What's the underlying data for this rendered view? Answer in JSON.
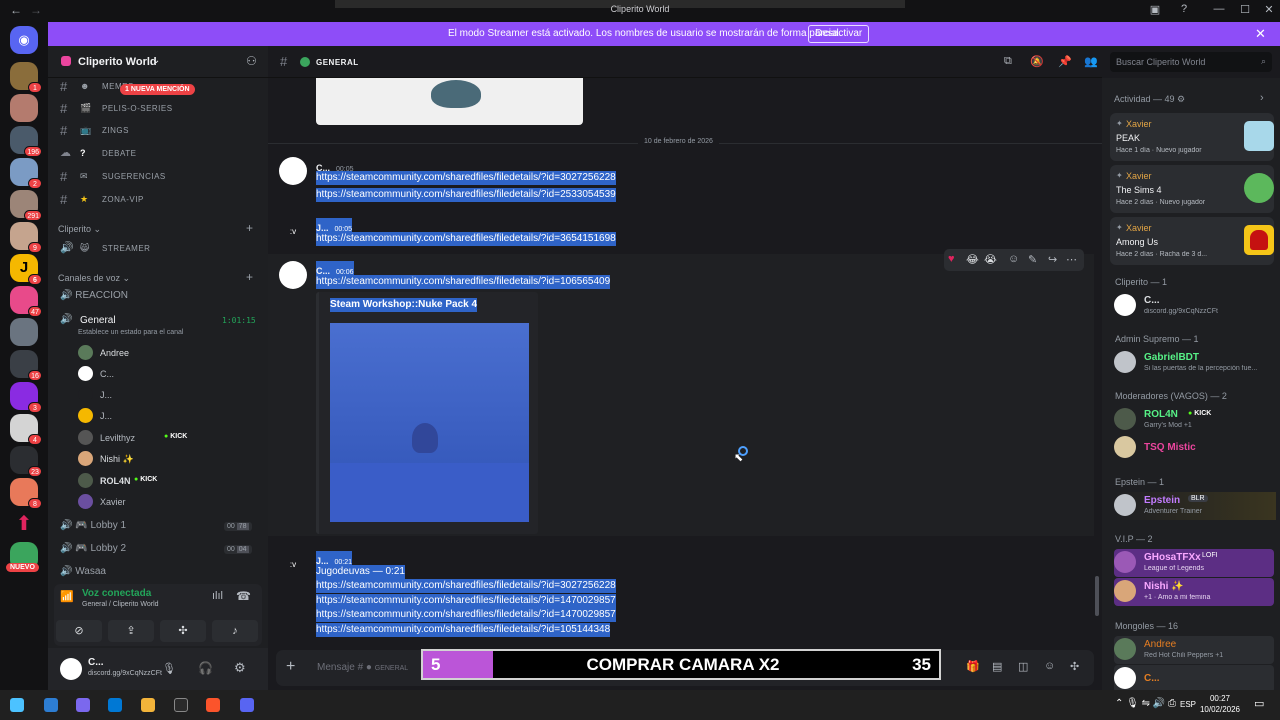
{
  "window": {
    "title": "Cliperito World"
  },
  "banner": {
    "text": "El modo Streamer está activado. Los nombres de usuario se mostrarán de forma parcial.",
    "button": "Desactivar"
  },
  "rail": {
    "badges": [
      "1",
      "196",
      "2",
      "291",
      "9",
      "6",
      "47",
      "16",
      "3",
      "4",
      "23",
      "8"
    ],
    "new_label": "NUEVO"
  },
  "sidebar": {
    "server_name": "Cliperito World",
    "mention_pill": "1 NUEVA MENCIÓN",
    "channels": [
      {
        "emoji": "☻",
        "label": "MEMES"
      },
      {
        "emoji": "🎬",
        "label": "PELIS-O-SERIES"
      },
      {
        "emoji": "📺",
        "label": "ZINGS"
      },
      {
        "emoji": "?",
        "label": "DEBATE"
      },
      {
        "emoji": "✉",
        "label": "SUGERENCIAS"
      },
      {
        "emoji": "★",
        "label": "ZONA-VIP"
      }
    ],
    "cat_cliperito": "Cliperito",
    "streamer_channel": "STREAMER",
    "cat_voice": "Canales de voz",
    "reaccion": "REACCION",
    "general_voice": "General",
    "general_time": "1:01:15",
    "general_status": "Establece un estado para el canal",
    "voice_users": [
      {
        "name": "Andree",
        "color": "#dbdee1"
      },
      {
        "name": "C...",
        "color": "#b5bac1"
      },
      {
        "name": "J...",
        "color": "#b5bac1"
      },
      {
        "name": "J...",
        "color": "#b5bac1"
      },
      {
        "name": "Levilthyz",
        "color": "#b5bac1",
        "tag": "KICK"
      },
      {
        "name": "Nishi ✨",
        "color": "#dbdee1"
      },
      {
        "name": "ROL4N",
        "color": "#dbdee1",
        "tag": "KICK"
      },
      {
        "name": "Xavier",
        "color": "#b5bac1"
      }
    ],
    "lobby1": "Lobby 1",
    "lobby1_a": "00",
    "lobby1_b": "78",
    "lobby2": "Lobby 2",
    "lobby2_a": "00",
    "lobby2_b": "04",
    "wasaa": "Wasaa",
    "voice_connected": "Voz conectada",
    "voice_location": "General / Cliperito World",
    "user_name": "C...",
    "user_status": "discord.gg/9xCqNzzCFt"
  },
  "chat": {
    "channel_name": "GENERAL",
    "date_divider": "10 de febrero de 2026",
    "messages": [
      {
        "author": "C...",
        "time": "00:05",
        "links": [
          "https://steamcommunity.com/sharedfiles/filedetails/?id=3027256228",
          "https://steamcommunity.com/sharedfiles/filedetails/?id=2533054539"
        ]
      },
      {
        "author": "J...",
        "time": "00:05",
        "links": [
          "https://steamcommunity.com/sharedfiles/filedetails/?id=3654151698"
        ]
      },
      {
        "author": "C...",
        "time": "00:06",
        "links": [
          "https://steamcommunity.com/sharedfiles/filedetails/?id=106565409"
        ]
      },
      {
        "author": "J...",
        "time": "00:21",
        "links": [
          "Jugodeuvas — 0:21",
          "https://steamcommunity.com/sharedfiles/filedetails/?id=3027256228",
          "https://steamcommunity.com/sharedfiles/filedetails/?id=1470029857",
          "https://steamcommunity.com/sharedfiles/filedetails/?id=1470029857",
          "https://steamcommunity.com/sharedfiles/filedetails/?id=105144348"
        ]
      }
    ],
    "embed_title": "Steam Workshop::Nuke Pack 4",
    "composer_placeholder": "Mensaje #",
    "composer_channel": "GENERAL"
  },
  "overlay": {
    "left_num": "5",
    "label": "COMPRAR CAMARA X2",
    "right_num": "35"
  },
  "members": {
    "search_placeholder": "Buscar Cliperito World",
    "activity_header": "Actividad — 49",
    "activities": [
      {
        "who": "Xavier",
        "game": "PEAK",
        "meta": "Hace 1 día · Nuevo jugador",
        "color": "#a8d8ea"
      },
      {
        "who": "Xavier",
        "game": "The Sims 4",
        "meta": "Hace 2 días · Nuevo jugador",
        "color": "#5cb85c"
      },
      {
        "who": "Xavier",
        "game": "Among Us",
        "meta": "Hace 2 días · Racha de 3 d...",
        "color": "#c51111"
      }
    ],
    "groups": [
      {
        "title": "Cliperito — 1",
        "members": [
          {
            "name": "C...",
            "status": "discord.gg/9xCqNzzCFt",
            "color": "#dbdee1"
          }
        ]
      },
      {
        "title": "Admin Supremo — 1",
        "members": [
          {
            "name": "GabrielBDT",
            "status": "Si las puertas de la percepción fue...",
            "color": "#57f287"
          }
        ]
      },
      {
        "title": "Moderadores (VAGOS) — 2",
        "members": [
          {
            "name": "ROL4N",
            "status": "Garry's Mod +1",
            "color": "#57f287",
            "tag": "KICK"
          },
          {
            "name": "TSQ Mistic",
            "status": "",
            "color": "#eb459e"
          }
        ]
      },
      {
        "title": "Epstein — 1",
        "members": [
          {
            "name": "Epstein",
            "status": "Adventurer Trainer",
            "color": "#c27cff",
            "tag": "BLR"
          }
        ]
      },
      {
        "title": "V.I.P — 2",
        "members": [
          {
            "name": "GHosaTFXx",
            "status": "League of Legends",
            "color": "#f9a8ff",
            "tag": "LOFI"
          },
          {
            "name": "Nishi ✨",
            "status": "+1 · Amo a mi femina",
            "color": "#f9a8ff"
          }
        ]
      },
      {
        "title": "Mongoles — 16",
        "members": [
          {
            "name": "Andree",
            "status": "Red Hot Chili Peppers +1",
            "color": "#e67e22"
          },
          {
            "name": "C...",
            "status": "",
            "color": "#e67e22"
          }
        ]
      }
    ]
  },
  "taskbar": {
    "lang": "ESP",
    "time": "00:27",
    "date": "10/02/2026"
  }
}
